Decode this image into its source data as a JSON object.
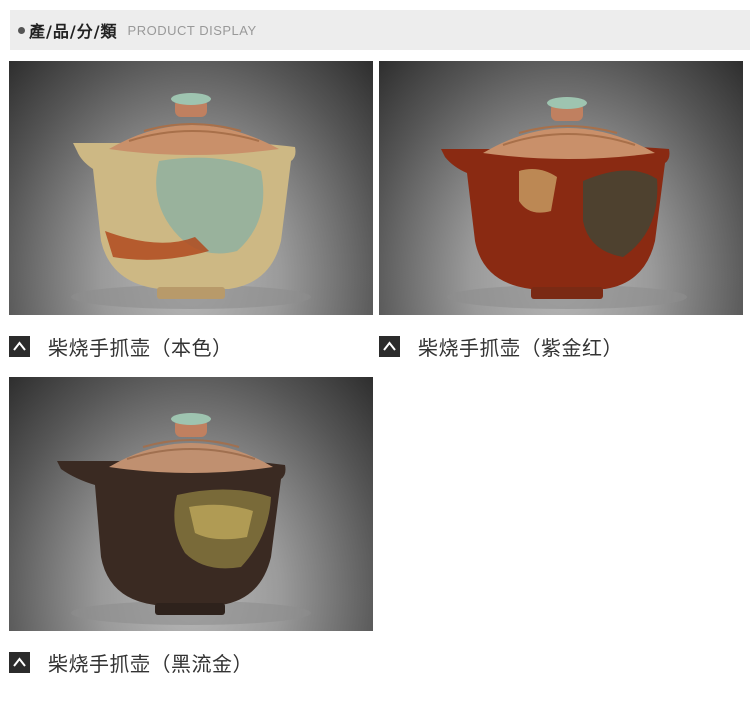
{
  "header": {
    "title_cn": "產/品/分/類",
    "title_en": "PRODUCT DISPLAY"
  },
  "products": [
    {
      "caption": "柴烧手抓壶（本色）",
      "body_color": "#cdb884",
      "accent": "#8fb0a0",
      "spot": "#b04a1e"
    },
    {
      "caption": "柴烧手抓壶（紫金红）",
      "body_color": "#8a2a12",
      "accent": "#3a4a3a",
      "spot": "#d2b070"
    },
    {
      "caption": "柴烧手抓壶（黑流金）",
      "body_color": "#3a2a22",
      "accent": "#8a7a40",
      "spot": "#c8b060"
    }
  ],
  "icons": {
    "caption": "chevron-up-icon",
    "bullet": "dot-icon"
  }
}
